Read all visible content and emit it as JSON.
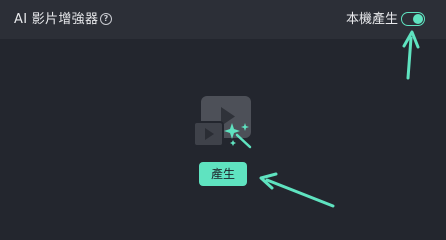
{
  "header": {
    "title": "AI 影片增強器",
    "help_icon": "question-circle-icon",
    "help_glyph": "?",
    "toggle_label": "本機產生",
    "toggle_on": true
  },
  "main": {
    "generate_label": "產生",
    "illustration_icons": [
      "video-play-icon",
      "sparkle-wand-icon"
    ]
  },
  "colors": {
    "accent": "#5fe3c0",
    "background": "#23262e",
    "header_background": "#2c2f37"
  }
}
